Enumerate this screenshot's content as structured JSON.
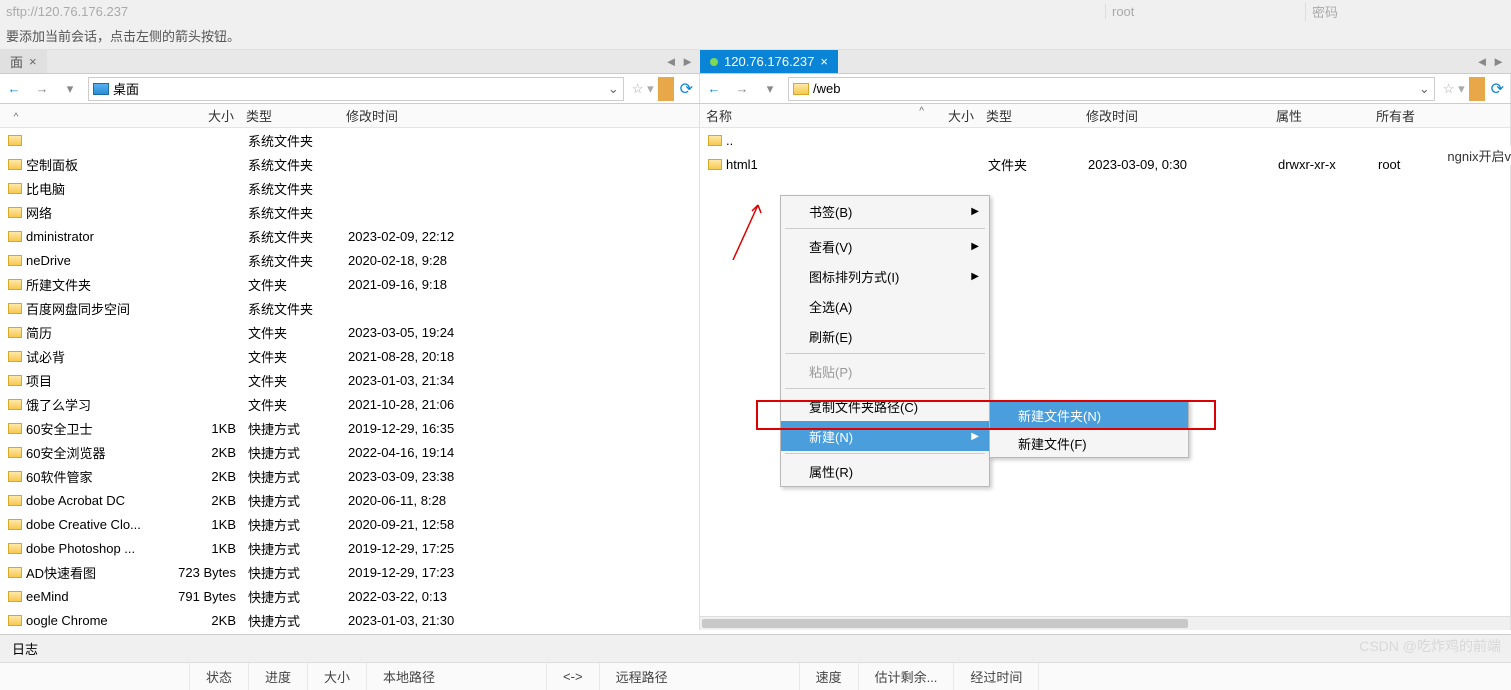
{
  "top": {
    "address": "sftp://120.76.176.237",
    "user": "root",
    "pwd": "密码"
  },
  "hint": "要添加当前会话，点击左侧的箭头按钮。",
  "tabs": {
    "local_label": "面",
    "remote_label": "120.76.176.237"
  },
  "nav": {
    "local_path": "桌面",
    "remote_path": "/web"
  },
  "headers": {
    "name": "名称",
    "size": "大小",
    "type": "类型",
    "mtime": "修改时间",
    "attr": "属性",
    "owner": "所有者"
  },
  "local_rows": [
    {
      "name": "",
      "size": "",
      "type": "系统文件夹",
      "mtime": ""
    },
    {
      "name": "空制面板",
      "size": "",
      "type": "系统文件夹",
      "mtime": ""
    },
    {
      "name": "比电脑",
      "size": "",
      "type": "系统文件夹",
      "mtime": ""
    },
    {
      "name": "网络",
      "size": "",
      "type": "系统文件夹",
      "mtime": ""
    },
    {
      "name": "dministrator",
      "size": "",
      "type": "系统文件夹",
      "mtime": "2023-02-09, 22:12"
    },
    {
      "name": "neDrive",
      "size": "",
      "type": "系统文件夹",
      "mtime": "2020-02-18, 9:28"
    },
    {
      "name": "所建文件夹",
      "size": "",
      "type": "文件夹",
      "mtime": "2021-09-16, 9:18"
    },
    {
      "name": "百度网盘同步空间",
      "size": "",
      "type": "系统文件夹",
      "mtime": ""
    },
    {
      "name": "简历",
      "size": "",
      "type": "文件夹",
      "mtime": "2023-03-05, 19:24"
    },
    {
      "name": "试必背",
      "size": "",
      "type": "文件夹",
      "mtime": "2021-08-28, 20:18"
    },
    {
      "name": "项目",
      "size": "",
      "type": "文件夹",
      "mtime": "2023-01-03, 21:34"
    },
    {
      "name": "饿了么学习",
      "size": "",
      "type": "文件夹",
      "mtime": "2021-10-28, 21:06"
    },
    {
      "name": "60安全卫士",
      "size": "1KB",
      "type": "快捷方式",
      "mtime": "2019-12-29, 16:35"
    },
    {
      "name": "60安全浏览器",
      "size": "2KB",
      "type": "快捷方式",
      "mtime": "2022-04-16, 19:14"
    },
    {
      "name": "60软件管家",
      "size": "2KB",
      "type": "快捷方式",
      "mtime": "2023-03-09, 23:38"
    },
    {
      "name": "dobe Acrobat DC",
      "size": "2KB",
      "type": "快捷方式",
      "mtime": "2020-06-11, 8:28"
    },
    {
      "name": "dobe Creative Clo...",
      "size": "1KB",
      "type": "快捷方式",
      "mtime": "2020-09-21, 12:58"
    },
    {
      "name": "dobe Photoshop ...",
      "size": "1KB",
      "type": "快捷方式",
      "mtime": "2019-12-29, 17:25"
    },
    {
      "name": "AD快速看图",
      "size": "723 Bytes",
      "type": "快捷方式",
      "mtime": "2019-12-29, 17:23"
    },
    {
      "name": "eeMind",
      "size": "791 Bytes",
      "type": "快捷方式",
      "mtime": "2022-03-22, 0:13"
    },
    {
      "name": "oogle Chrome",
      "size": "2KB",
      "type": "快捷方式",
      "mtime": "2023-01-03, 21:30"
    }
  ],
  "remote_rows": [
    {
      "name": "..",
      "size": "",
      "type": "",
      "mtime": "",
      "attr": "",
      "owner": ""
    },
    {
      "name": "html1",
      "size": "",
      "type": "文件夹",
      "mtime": "2023-03-09, 0:30",
      "attr": "drwxr-xr-x",
      "owner": "root"
    }
  ],
  "ctx": {
    "bookmark": "书签(B)",
    "view": "查看(V)",
    "iconarrange": "图标排列方式(I)",
    "selectall": "全选(A)",
    "refresh": "刷新(E)",
    "paste": "粘贴(P)",
    "copypath": "复制文件夹路径(C)",
    "new": "新建(N)",
    "props": "属性(R)"
  },
  "sub": {
    "newfolder": "新建文件夹(N)",
    "newfile": "新建文件(F)"
  },
  "bottom": {
    "log": "日志"
  },
  "status": {
    "state": "状态",
    "progress": "进度",
    "size": "大小",
    "localpath": "本地路径",
    "arrows": "<->",
    "remotepath": "远程路径",
    "speed": "速度",
    "estremain": "估计剩余...",
    "elapsed": "经过时间"
  },
  "watermark": "CSDN @吃炸鸡的前端",
  "cutlabel": "ngnix开启v"
}
